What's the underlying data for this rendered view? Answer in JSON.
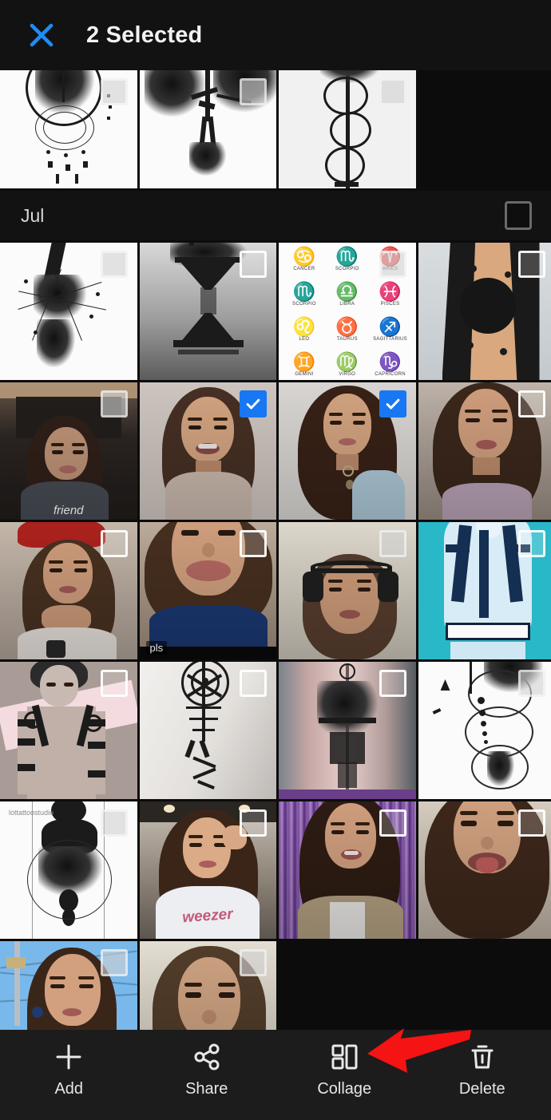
{
  "header": {
    "close_icon": "close-x-icon",
    "close_color": "#1e8cf5",
    "title": "2 Selected"
  },
  "month_section": {
    "label": "Jul",
    "select_all_checked": false
  },
  "selection": {
    "selected_count": 2,
    "checkbox_checked_color": "#1877f2",
    "check_glyph": "checkmark-icon"
  },
  "grid": {
    "rows": [
      {
        "id": "row-top-partial",
        "partial_top": true,
        "cells": [
          {
            "name": "dreamcatcher-wolf-tattoo-sketch",
            "art": "dreamcatcher",
            "checked": false,
            "faint": true,
            "caption": ""
          },
          {
            "name": "winged-angel-demon-tattoo-sketch",
            "art": "winged-figure",
            "checked": false,
            "faint": true,
            "caption": ""
          },
          {
            "name": "snake-sword-tattoo-sketch",
            "art": "snake-sword",
            "checked": false,
            "faint": true,
            "caption": ""
          }
        ]
      },
      {
        "id": "row-jul-1",
        "partial_top": false,
        "cells": [
          {
            "name": "abstract-burst-sketch",
            "art": "burst",
            "checked": false,
            "faint": true,
            "caption": ""
          },
          {
            "name": "hourglass-forest-artwork",
            "art": "hourglass",
            "checked": false,
            "faint": false,
            "caption": ""
          },
          {
            "name": "zodiac-symbols-chart",
            "art": "zodiac",
            "checked": false,
            "faint": true,
            "caption": ""
          },
          {
            "name": "blackwork-hand-tattoo-photo",
            "art": "hand-tattoo",
            "checked": false,
            "faint": false,
            "caption": ""
          }
        ]
      },
      {
        "id": "row-jul-2",
        "partial_top": false,
        "cells": [
          {
            "name": "selfie-cafe-booth",
            "art": "photo-cafe",
            "checked": false,
            "faint": true,
            "caption": "friend"
          },
          {
            "name": "selfie-smiling-turtleneck",
            "art": "photo-smile",
            "checked": true,
            "faint": false,
            "caption": ""
          },
          {
            "name": "portrait-blue-top",
            "art": "photo-portrait",
            "checked": true,
            "faint": false,
            "caption": ""
          },
          {
            "name": "selfie-lilac-strap",
            "art": "photo-lilac",
            "checked": false,
            "faint": false,
            "caption": ""
          }
        ]
      },
      {
        "id": "row-jul-3",
        "partial_top": false,
        "cells": [
          {
            "name": "selfie-red-beret",
            "art": "photo-beret",
            "checked": false,
            "faint": false,
            "caption": ""
          },
          {
            "name": "selfie-pouting-blue-shirt",
            "art": "photo-pout",
            "checked": false,
            "faint": false,
            "caption": "pls"
          },
          {
            "name": "selfie-headphones",
            "art": "photo-headphones",
            "checked": false,
            "faint": true,
            "caption": ""
          },
          {
            "name": "anime-back-tattoo-illustration",
            "art": "anime-cyan",
            "checked": false,
            "faint": false,
            "caption": ""
          }
        ]
      },
      {
        "id": "row-jul-4",
        "partial_top": false,
        "cells": [
          {
            "name": "anime-character-tattoo-design",
            "art": "anime-pink",
            "checked": false,
            "faint": false,
            "caption": ""
          },
          {
            "name": "nordic-runes-arm-tattoo",
            "art": "runes",
            "checked": false,
            "faint": false,
            "caption": ""
          },
          {
            "name": "forearm-sketch-tattoo-photo",
            "art": "forearm",
            "checked": false,
            "faint": false,
            "caption": ""
          },
          {
            "name": "dna-helix-tattoo-sketch",
            "art": "dna",
            "checked": false,
            "faint": true,
            "caption": ""
          }
        ]
      },
      {
        "id": "row-jul-5",
        "partial_top": false,
        "cells": [
          {
            "name": "anatomical-lotus-tattoo-sketch",
            "art": "anatomy",
            "checked": false,
            "faint": true,
            "caption": "lottattoostudio"
          },
          {
            "name": "selfie-weezer-tee",
            "art": "photo-weezer",
            "checked": false,
            "faint": false,
            "caption": "weezer"
          },
          {
            "name": "selfie-purple-fringe-backdrop",
            "art": "photo-purple",
            "checked": false,
            "faint": false,
            "caption": ""
          },
          {
            "name": "selfie-tongue-out",
            "art": "photo-tongue",
            "checked": false,
            "faint": false,
            "caption": ""
          }
        ]
      },
      {
        "id": "row-jul-6-partial",
        "partial_top": false,
        "cells": [
          {
            "name": "selfie-outdoor-blue-sky",
            "art": "photo-sky",
            "checked": false,
            "faint": true,
            "caption": ""
          },
          {
            "name": "selfie-bed-closeup",
            "art": "photo-bed",
            "checked": false,
            "faint": true,
            "caption": ""
          }
        ]
      }
    ]
  },
  "bottom_bar": {
    "items": [
      {
        "name": "add-button",
        "icon": "plus-icon",
        "label": "Add"
      },
      {
        "name": "share-button",
        "icon": "share-nodes-icon",
        "label": "Share"
      },
      {
        "name": "collage-button",
        "icon": "collage-grid-icon",
        "label": "Collage"
      },
      {
        "name": "delete-button",
        "icon": "trash-icon",
        "label": "Delete"
      }
    ]
  },
  "annotation": {
    "arrow_color": "#f51313",
    "points_at": "collage-button"
  },
  "zodiac_chart": {
    "items": [
      {
        "glyph": "♋",
        "name": "CANCER"
      },
      {
        "glyph": "♏",
        "name": "SCORPIO"
      },
      {
        "glyph": "♈",
        "name": "ARIES"
      },
      {
        "glyph": "♏",
        "name": "SCORPIO"
      },
      {
        "glyph": "♎",
        "name": "LIBRA"
      },
      {
        "glyph": "♓",
        "name": "PISCES"
      },
      {
        "glyph": "♌",
        "name": "LEO"
      },
      {
        "glyph": "♉",
        "name": "TAURUS"
      },
      {
        "glyph": "♐",
        "name": "SAGITTARIUS"
      },
      {
        "glyph": "♊",
        "name": "GEMINI"
      },
      {
        "glyph": "♍",
        "name": "VIRGO"
      },
      {
        "glyph": "♑",
        "name": "CAPRICORN"
      }
    ]
  }
}
